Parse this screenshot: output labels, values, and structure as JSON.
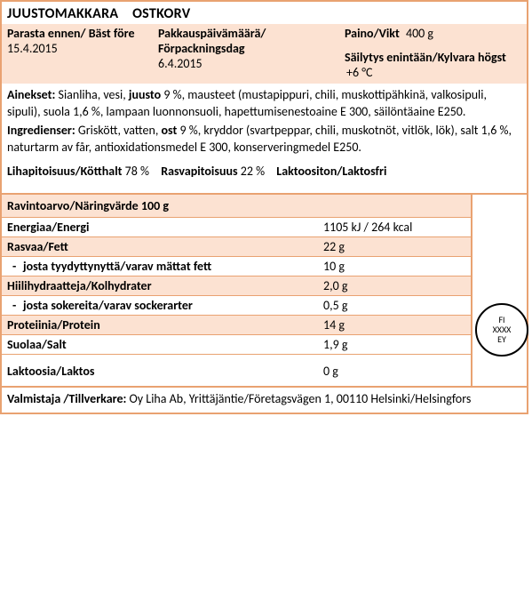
{
  "title_fi": "JUUSTOMAKKARA",
  "title_sv": "OSTKORV",
  "header": {
    "bestbefore_label": "Parasta ennen/ Bäst före",
    "bestbefore_value": "15.4.2015",
    "packdate_label": "Pakkauspäivämäärä/ Förpackningsdag",
    "packdate_value": "6.4.2015",
    "weight_label": "Paino/Vikt",
    "weight_value": "400 g",
    "storage_label": "Säilytys enintään/Kylvara högst",
    "storage_value": "+6 °C"
  },
  "ingredients": {
    "fi_label": "Ainekset:",
    "fi_pre": " Sianliha, vesi, ",
    "fi_cheese": "juusto",
    "fi_post": " 9 %, mausteet (mustapippuri, chili, muskottipähkinä, valkosipuli, sipuli), suola 1,6 %, lampaan luonnonsuoli, hapettumisenestoaine  E 300, säilöntäaine  E250.",
    "sv_label": "Ingredienser:",
    "sv_pre": " Griskött, vatten, ",
    "sv_cheese": "ost",
    "sv_post": " 9 %, kryddor (svartpeppar, chili, muskotnöt, vitlök, lök), salt 1,6 %, naturtarm av får, antioxidationsmedel E 300, konserveringmedel E250."
  },
  "percents": {
    "meat_label": "Lihapitoisuus/Kötthalt",
    "meat_value": "78 %",
    "fat_label": "Rasvapitoisuus",
    "fat_value": "22 %",
    "lacfree_label": "Laktoositon/Laktosfri"
  },
  "nutrition": {
    "header": "Ravintoarvo/Näringvärde  100 g",
    "rows": [
      {
        "label": "Energiaa/Energi",
        "value": "1105 kJ / 264 kcal",
        "sub": false,
        "alt": false
      },
      {
        "label": "Rasvaa/Fett",
        "value": "22 g",
        "sub": false,
        "alt": true
      },
      {
        "label": "josta tyydyttynyttä/varav mättat fett",
        "value": "10 g",
        "sub": true,
        "alt": false
      },
      {
        "label": "Hiilihydraatteja/Kolhydrater",
        "value": "2,0 g",
        "sub": false,
        "alt": true
      },
      {
        "label": "josta sokereita/varav sockerarter",
        "value": "0,5 g",
        "sub": true,
        "alt": false
      },
      {
        "label": "Proteiinia/Protein",
        "value": "14 g",
        "sub": false,
        "alt": true
      },
      {
        "label": "Suolaa/Salt",
        "value": "1,9 g",
        "sub": false,
        "alt": false
      }
    ],
    "lactose_label": "Laktoosia/Laktos",
    "lactose_value": "0 g"
  },
  "stamp": {
    "line1": "FI",
    "line2": "XXXX",
    "line3": "EY"
  },
  "manufacturer": {
    "label": "Valmistaja /Tillverkare:",
    "value": " Oy Liha Ab, Yrittäjäntie/Företagsvägen 1, 00110 Helsinki/Helsingfors"
  }
}
